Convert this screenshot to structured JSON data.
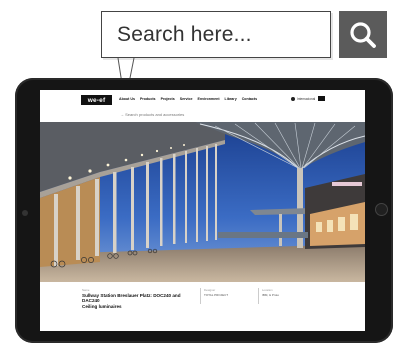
{
  "search": {
    "placeholder": "Search here...",
    "button_icon": "search-icon",
    "button_color": "#5b5b5b"
  },
  "site": {
    "logo": "we-ef",
    "menu": [
      "About Us",
      "Products",
      "Projects",
      "Service",
      "Environment",
      "Library",
      "Contacts"
    ],
    "language": "Internacional",
    "search_hint": "→ Search products and accessories"
  },
  "caption": {
    "kicker": "Name",
    "title_line1": "Sullway Station Breslauer Platz: DOC240 and DAC240",
    "title_line2": "Ceiling luminaires",
    "designer_label": "Designer",
    "designer_value": "TOTAL PROJECT",
    "location_label": "Location",
    "location_value": "IBM, & Proto"
  }
}
